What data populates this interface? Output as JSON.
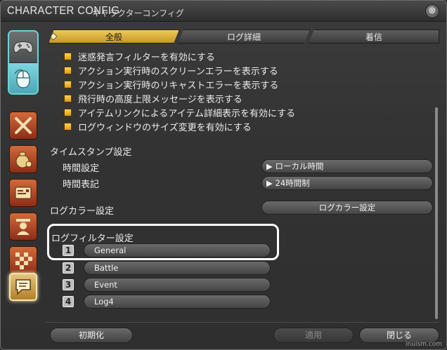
{
  "window": {
    "title": "CHARACTER CONFIG",
    "subtitle": "キャラクターコンフィグ",
    "close_glyph": "⊗"
  },
  "sidebar": {
    "items": [
      {
        "name": "gamepad-icon"
      },
      {
        "name": "mouse-icon"
      },
      {
        "name": "crossed-swords-icon"
      },
      {
        "name": "money-bag-icon"
      },
      {
        "name": "card-icon"
      },
      {
        "name": "character-icon"
      },
      {
        "name": "checkered-flag-icon"
      },
      {
        "name": "chat-log-icon",
        "active": true
      }
    ]
  },
  "tabs": [
    "全般",
    "ログ詳細",
    "着信"
  ],
  "checkboxes": [
    "迷惑発言フィルターを有効にする",
    "アクション実行時のスクリーンエラーを表示する",
    "アクション実行時のリキャストエラーを表示する",
    "飛行時の高度上限メッセージを表示する",
    "アイテムリンクによるアイテム詳細表示を有効にする",
    "ログウィンドウのサイズ変更を有効にする"
  ],
  "timestamp": {
    "heading": "タイムスタンプ設定",
    "time_setting_label": "時間設定",
    "time_setting_value": "▶ ローカル時間",
    "time_format_label": "時間表記",
    "time_format_value": "▶ 24時間制"
  },
  "log_color": {
    "label": "ログカラー設定",
    "button": "ログカラー設定"
  },
  "log_filter": {
    "heading": "ログフィルター設定",
    "filters": [
      {
        "num": "1",
        "name": "General"
      },
      {
        "num": "2",
        "name": "Battle"
      },
      {
        "num": "3",
        "name": "Event"
      },
      {
        "num": "4",
        "name": "Log4"
      }
    ]
  },
  "footer": {
    "reset": "初期化",
    "apply": "適用",
    "close": "閉じる"
  },
  "watermark": "inuism.com"
}
